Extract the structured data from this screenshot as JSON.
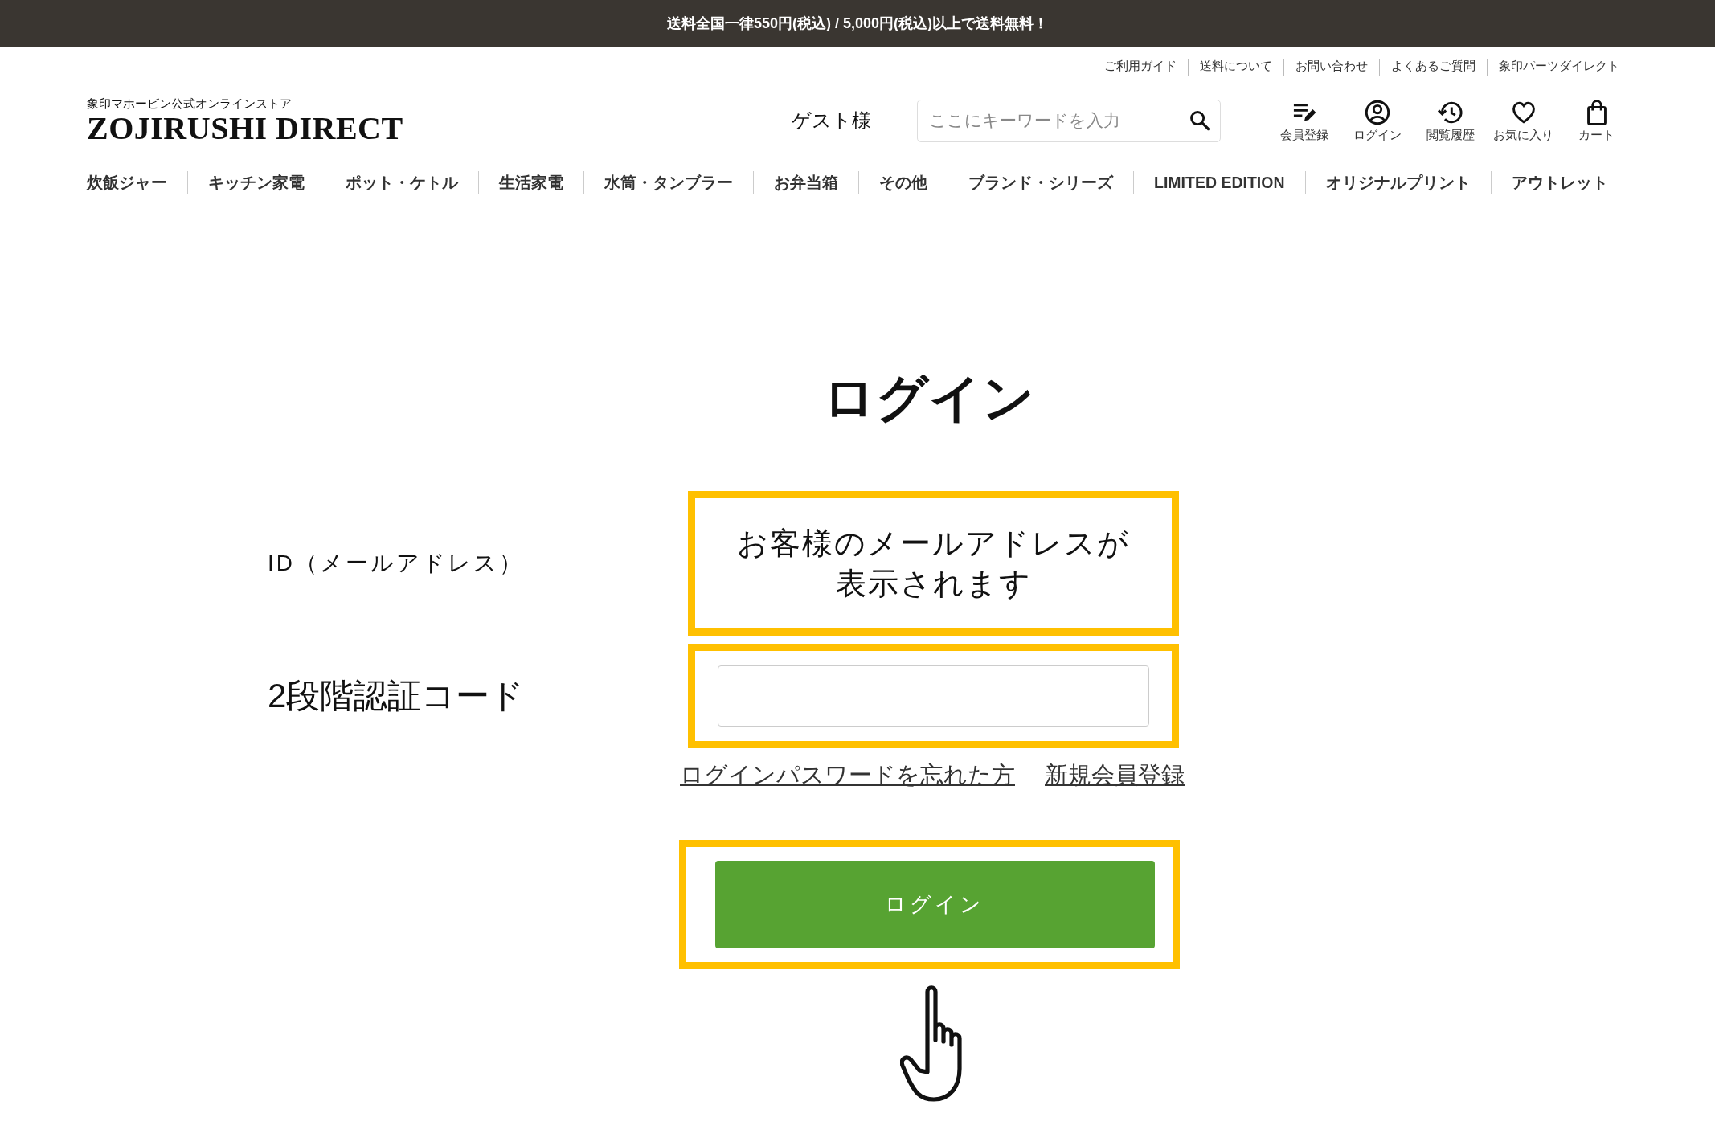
{
  "announcement": "送料全国一律550円(税込) / 5,000円(税込)以上で送料無料！",
  "utility_links": [
    "ご利用ガイド",
    "送料について",
    "お問い合わせ",
    "よくあるご質問",
    "象印パーツダイレクト"
  ],
  "logo": {
    "subtitle": "象印マホービン公式オンラインストア",
    "title": "ZOJIRUSHI DIRECT"
  },
  "guest_label": "ゲスト様",
  "search": {
    "placeholder": "ここにキーワードを入力"
  },
  "header_icons": [
    {
      "kind": "register",
      "label": "会員登録"
    },
    {
      "kind": "account",
      "label": "ログイン"
    },
    {
      "kind": "history",
      "label": "閲覧履歴"
    },
    {
      "kind": "favorite",
      "label": "お気に入り"
    },
    {
      "kind": "cart",
      "label": "カート"
    }
  ],
  "nav": [
    "炊飯ジャー",
    "キッチン家電",
    "ポット・ケトル",
    "生活家電",
    "水筒・タンブラー",
    "お弁当箱",
    "その他",
    "ブランド・シリーズ",
    "LIMITED EDITION",
    "オリジナルプリント",
    "アウトレット"
  ],
  "login": {
    "title": "ログイン",
    "fields": [
      {
        "kind": "display",
        "label": "ID（メールアドレス）",
        "value": "お客様のメールアドレスが表示されます",
        "highlighted": true
      },
      {
        "kind": "input",
        "label": "2段階認証コード",
        "highlighted": true
      }
    ],
    "links": [
      "ログインパスワードを忘れた方",
      "新規会員登録"
    ],
    "button": {
      "label": "ログイン",
      "highlighted": true
    }
  }
}
